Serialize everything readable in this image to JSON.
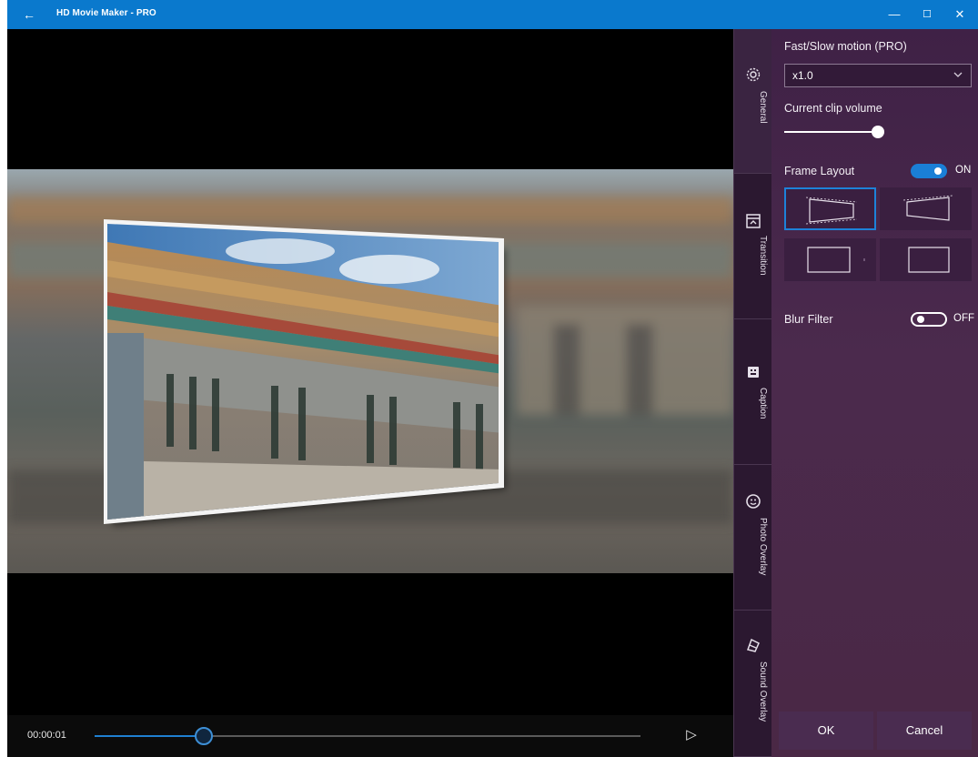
{
  "window": {
    "title": "HD Movie Maker - PRO",
    "back_icon": "←",
    "minimize_icon": "—",
    "maximize_icon": "☐",
    "close_icon": "✕",
    "titlebar_color": "#0a79cd"
  },
  "player": {
    "time": "00:00:01",
    "progress": 0.2,
    "play_icon": "▷"
  },
  "tabs": [
    {
      "label": "General",
      "icon": "gear-icon",
      "active": true
    },
    {
      "label": "Transition",
      "icon": "transition-icon",
      "active": false
    },
    {
      "label": "Caption",
      "icon": "caption-icon",
      "active": false
    },
    {
      "label": "Photo Overlay",
      "icon": "smiley-icon",
      "active": false
    },
    {
      "label": "Sound Overlay",
      "icon": "sound-overlay-icon",
      "active": false
    }
  ],
  "panel": {
    "speed": {
      "label": "Fast/Slow motion (PRO)",
      "value": "x1.0"
    },
    "volume": {
      "label": "Current clip volume",
      "value": 0.5
    },
    "frame_layout": {
      "label": "Frame Layout",
      "state": "ON",
      "on": true,
      "selected_index": 0
    },
    "blur_filter": {
      "label": "Blur Filter",
      "state": "OFF",
      "on": false
    },
    "ok_label": "OK",
    "cancel_label": "Cancel"
  },
  "colors": {
    "accent": "#1a7fd6",
    "panel_bg": "#3f2146",
    "tab_bg": "#2b1830"
  }
}
